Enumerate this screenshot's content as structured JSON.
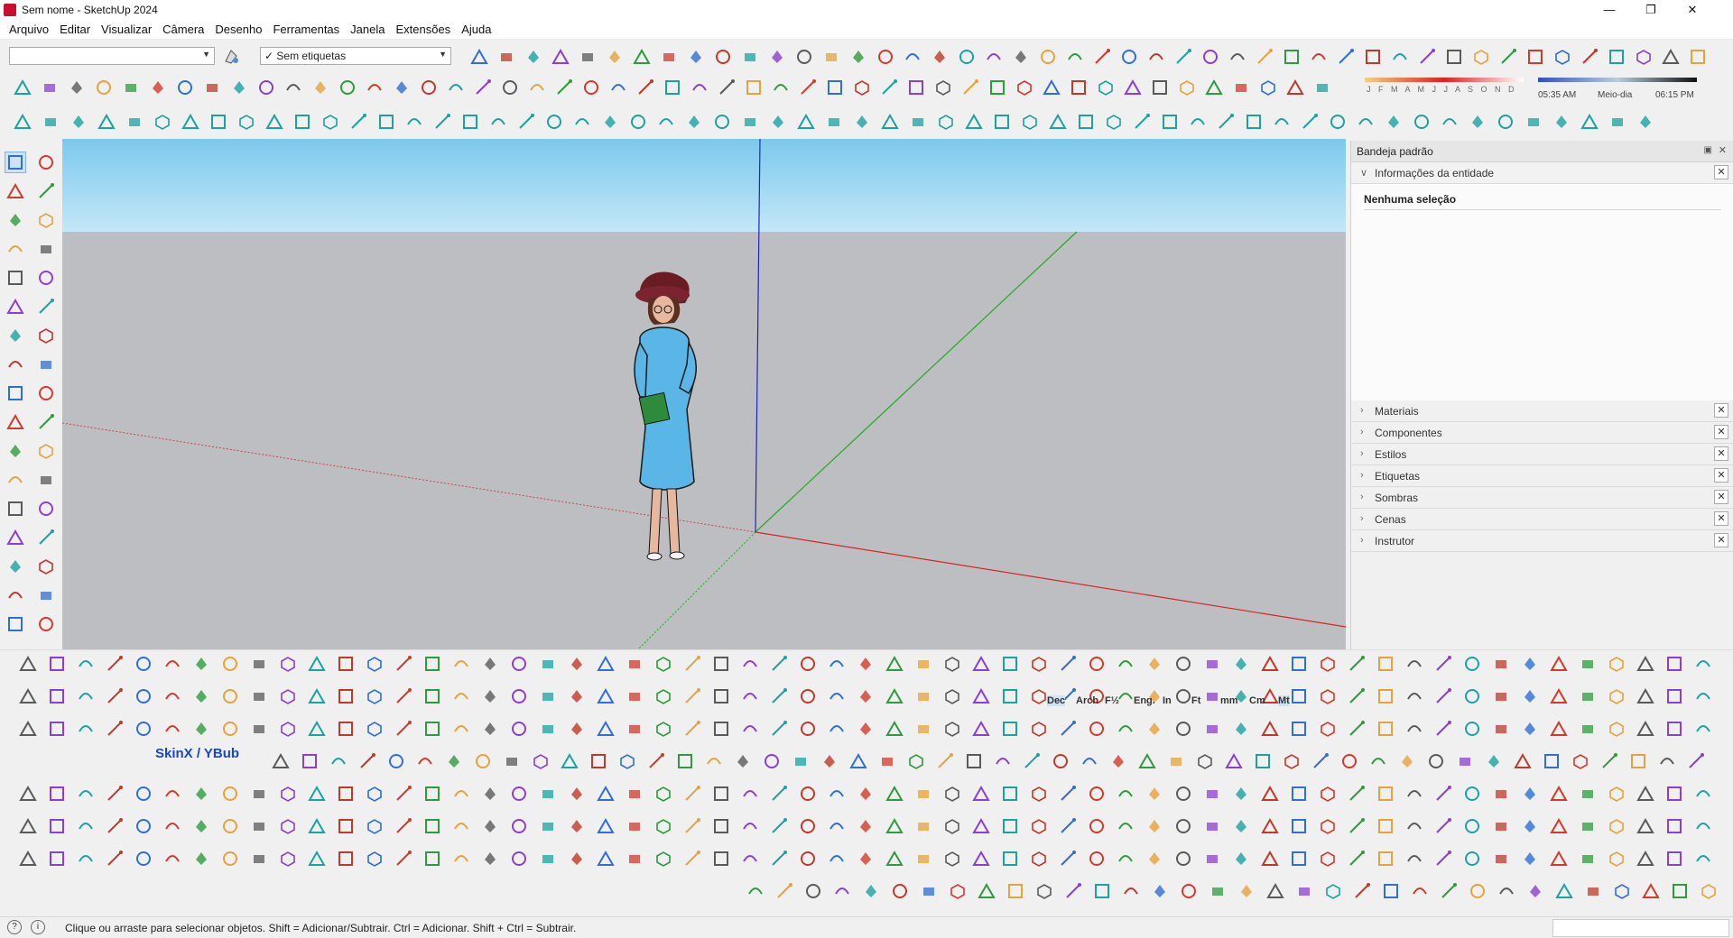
{
  "window": {
    "title": "Sem nome - SketchUp 2024"
  },
  "menus": [
    "Arquivo",
    "Editar",
    "Visualizar",
    "Câmera",
    "Desenho",
    "Ferramentas",
    "Janela",
    "Extensões",
    "Ajuda"
  ],
  "toolbar": {
    "tag_dropdown": "✓ Sem etiquetas"
  },
  "shadow": {
    "months": "J F M A M J J A S O N D",
    "time_start": "05:35 AM",
    "time_mid": "Meio-dia",
    "time_end": "06:15 PM"
  },
  "tray": {
    "title": "Bandeja padrão",
    "entity_panel": "Informações da entidade",
    "no_selection": "Nenhuma seleção",
    "panels": [
      "Materiais",
      "Componentes",
      "Estilos",
      "Etiquetas",
      "Sombras",
      "Cenas",
      "Instrutor"
    ]
  },
  "bottom": {
    "skinx": "SkinX / YBub",
    "units": [
      "Dec",
      "Arch",
      "F½",
      "Eng.",
      "In",
      "Ft",
      "mm",
      "Cm",
      "Mt"
    ]
  },
  "status": {
    "text": "Clique ou arraste para selecionar objetos. Shift = Adicionar/Subtrair. Ctrl = Adicionar. Shift + Ctrl = Subtrair."
  },
  "colors": {
    "sky": "#9fd6f1",
    "ground": "#bdbec1",
    "axis_red": "#d22",
    "axis_green": "#2a2",
    "axis_blue": "#22c",
    "dress": "#5ab6e6"
  }
}
